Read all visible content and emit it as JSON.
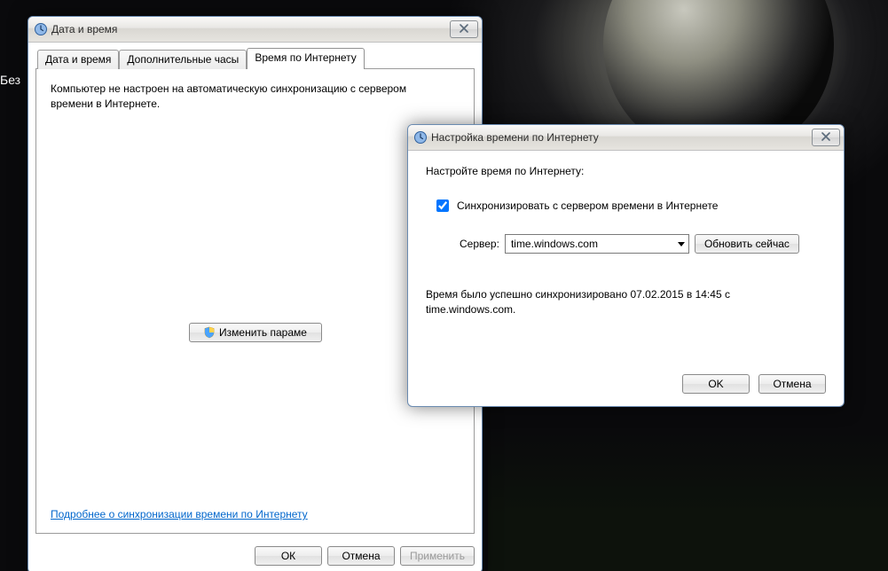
{
  "desktop": {
    "partial_text": "Без"
  },
  "main_dialog": {
    "title": "Дата и время",
    "tabs": {
      "datetime": "Дата и время",
      "extra_clocks": "Дополнительные часы",
      "internet_time": "Время по Интернету"
    },
    "active_tab": "internet_time",
    "info_text": "Компьютер не настроен на автоматическую синхронизацию с сервером времени в Интернете.",
    "change_button": "Изменить параме",
    "link": "Подробнее о синхронизации времени по Интернету",
    "buttons": {
      "ok": "ОК",
      "cancel": "Отмена",
      "apply": "Применить"
    }
  },
  "sub_dialog": {
    "title": "Настройка времени по Интернету",
    "heading": "Настройте время по Интернету:",
    "checkbox_label": "Синхронизировать с сервером времени в Интернете",
    "checkbox_checked": true,
    "server_label": "Сервер:",
    "server_value": "time.windows.com",
    "update_button": "Обновить сейчас",
    "status_text": "Время было успешно синхронизировано 07.02.2015 в 14:45 с time.windows.com.",
    "buttons": {
      "ok": "OK",
      "cancel": "Отмена"
    }
  }
}
